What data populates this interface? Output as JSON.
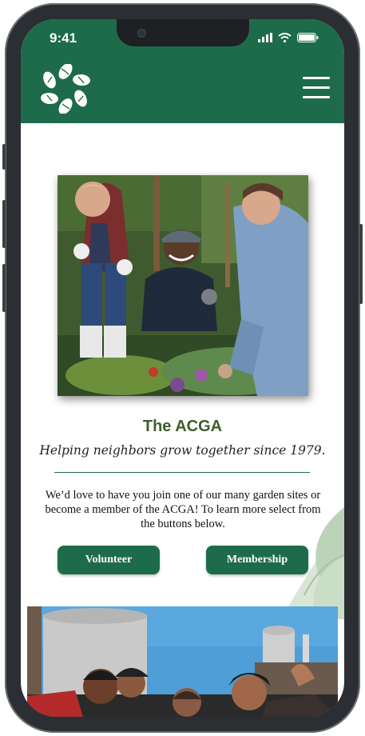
{
  "status_bar": {
    "time": "9:41"
  },
  "header": {
    "logo_icon": "leaf-wreath-logo",
    "menu_icon": "hamburger-menu-icon"
  },
  "main": {
    "title": "The ACGA",
    "tagline": "Helping neighbors grow together since 1979.",
    "intro": "We’d love to have you join one of our many garden sites or become a member of the ACGA! To learn more select from the buttons below.",
    "buttons": {
      "volunteer": "Volunteer",
      "membership": "Membership"
    }
  },
  "colors": {
    "brand_green": "#1d6b4b",
    "title_green": "#3d5e2c"
  }
}
